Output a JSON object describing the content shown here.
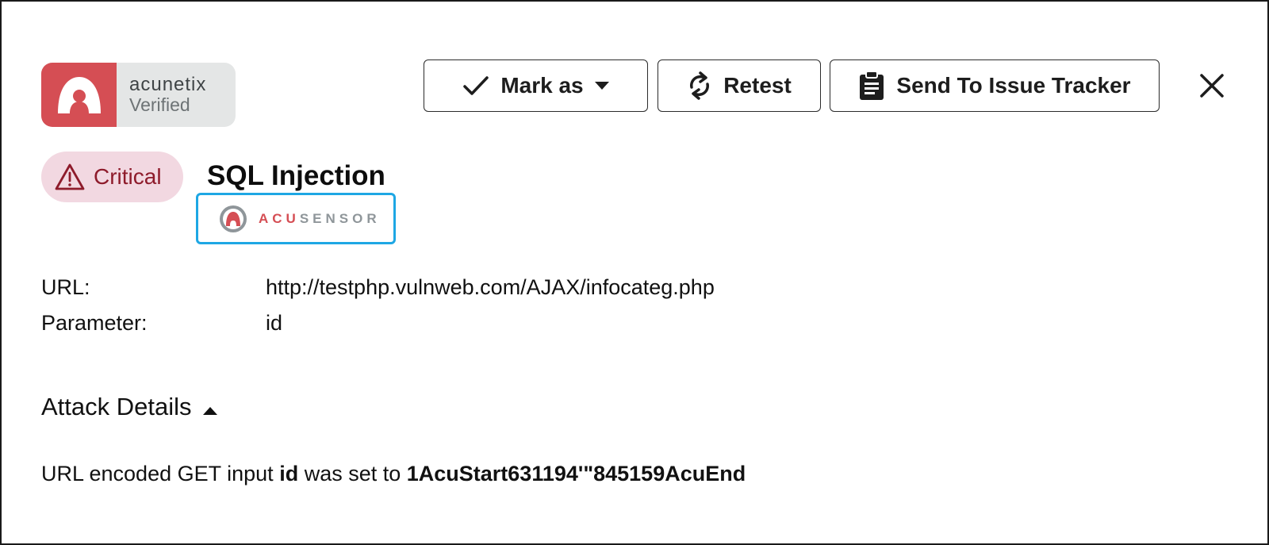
{
  "logo": {
    "name": "acunetix",
    "status": "Verified"
  },
  "toolbar": {
    "mark_label": "Mark as",
    "retest_label": "Retest",
    "send_label": "Send To Issue Tracker"
  },
  "vulnerability": {
    "severity": "Critical",
    "title": "SQL Injection",
    "sensor_brand_a": "ACU",
    "sensor_brand_b": "SENSOR"
  },
  "details": {
    "url_label": "URL:",
    "url_value": "http://testphp.vulnweb.com/AJAX/infocateg.php",
    "param_label": "Parameter:",
    "param_value": "id"
  },
  "attack": {
    "section_title": "Attack Details",
    "text_1": "URL encoded GET input ",
    "input_name": "id",
    "text_2": " was set to ",
    "input_value": "1AcuStart631194'\"845159AcuEnd"
  },
  "colors": {
    "brand_red": "#d54e54",
    "critical_bg": "#f2d8e1",
    "critical_text": "#8e1b2b",
    "sensor_border": "#1ea7e4"
  },
  "icons": [
    "acunetix-logo-icon",
    "check-icon",
    "caret-down-icon",
    "refresh-icon",
    "clipboard-icon",
    "close-icon",
    "warning-icon",
    "acusensor-icon",
    "caret-up-icon"
  ]
}
